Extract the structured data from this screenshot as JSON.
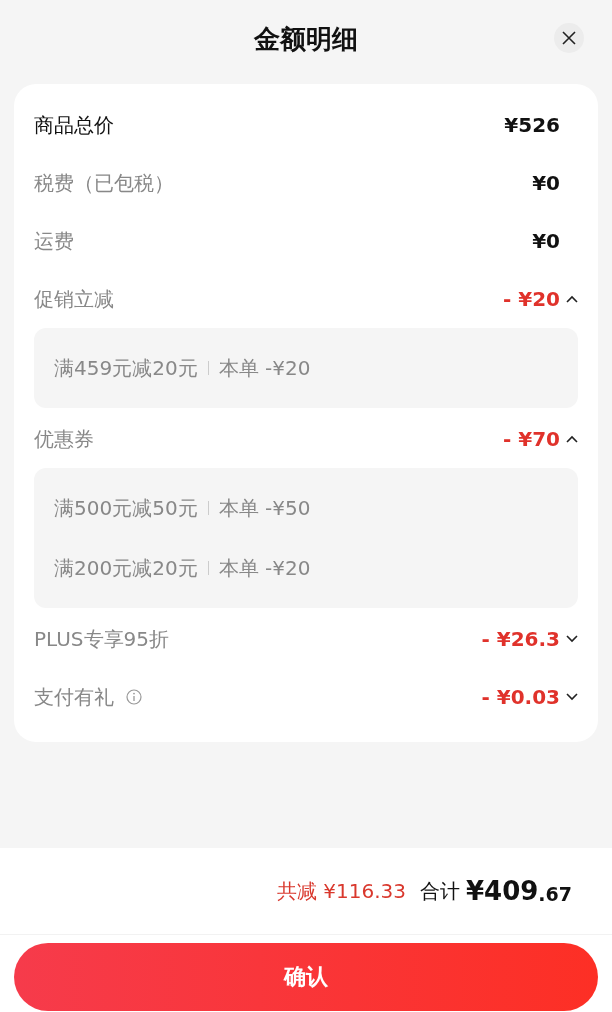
{
  "header": {
    "title": "金额明细"
  },
  "rows": [
    {
      "kind": "subtotal",
      "label": "商品总价",
      "amount": "¥526"
    },
    {
      "kind": "fee",
      "label": "税费（已包税）",
      "amount": "¥0"
    },
    {
      "kind": "fee",
      "label": "运费",
      "amount": "¥0"
    },
    {
      "kind": "discount",
      "label": "促销立减",
      "amount": "- ¥20",
      "expanded": true,
      "details": [
        {
          "condition": "满459元减20元",
          "amount": "本单 -¥20"
        }
      ]
    },
    {
      "kind": "discount",
      "label": "优惠券",
      "amount": "- ¥70",
      "expanded": true,
      "details": [
        {
          "condition": "满500元减50元",
          "amount": "本单 -¥50"
        },
        {
          "condition": "满200元减20元",
          "amount": "本单 -¥20"
        }
      ]
    },
    {
      "kind": "discount",
      "label": "PLUS专享95折",
      "amount": "- ¥26.3",
      "expanded": false
    },
    {
      "kind": "discount",
      "label": "支付有礼",
      "amount": "- ¥0.03",
      "expanded": false,
      "info": true
    }
  ],
  "summary": {
    "saved": "共减 ¥116.33",
    "total_label": "合计",
    "total_main": "¥409",
    "total_fraction": ".67"
  },
  "confirm_button": "确认"
}
